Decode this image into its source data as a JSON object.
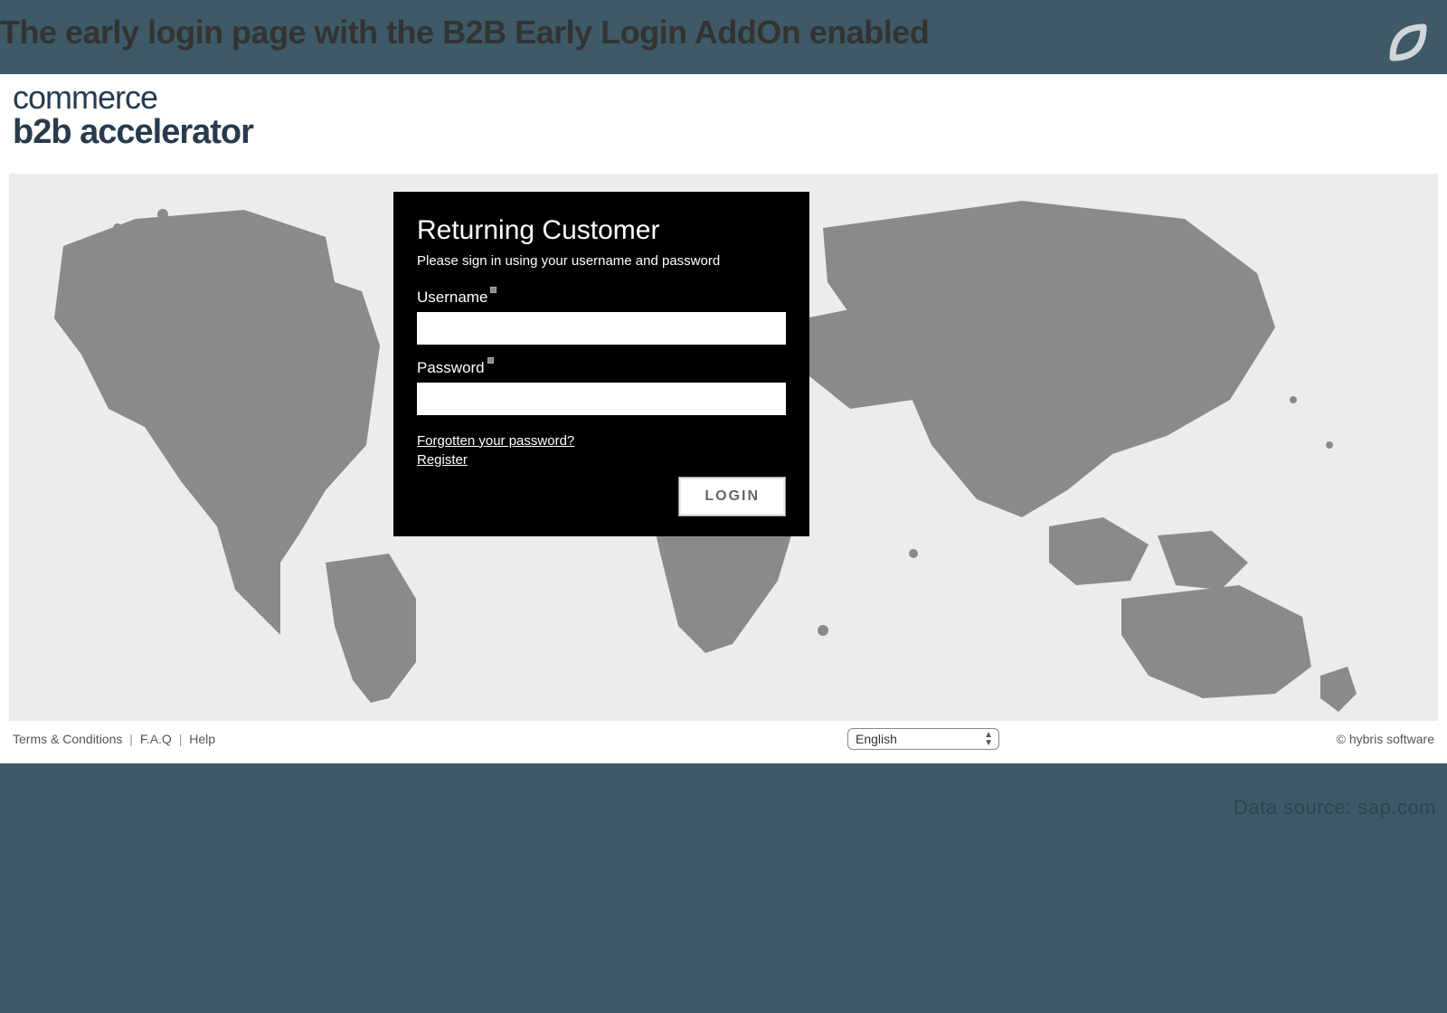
{
  "header": {
    "title": "The early login page with the B2B Early Login AddOn enabled"
  },
  "logo": {
    "line1": "commerce",
    "line2": "b2b accelerator"
  },
  "login": {
    "title": "Returning Customer",
    "subtitle": "Please sign in using your username and password",
    "username_label": "Username",
    "password_label": "Password",
    "forgot_link": "Forgotten your password?",
    "register_link": "Register",
    "button_label": "LOGIN"
  },
  "footer": {
    "terms": "Terms & Conditions",
    "faq": "F.A.Q",
    "help": "Help",
    "language_selected": "English",
    "copyright": "© hybris software"
  },
  "meta": {
    "data_source": "Data source: sap.com"
  }
}
